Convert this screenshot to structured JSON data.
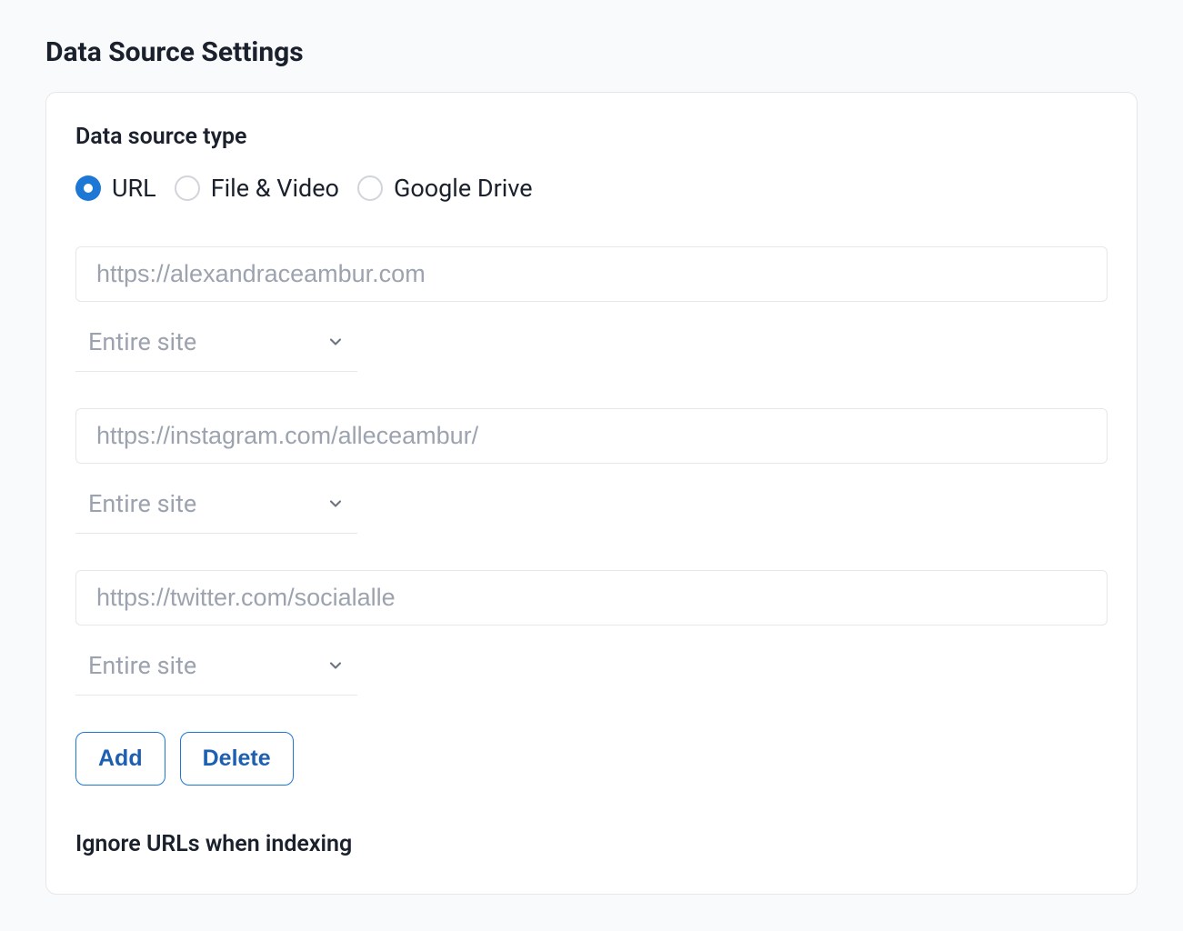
{
  "page": {
    "title": "Data Source Settings"
  },
  "card": {
    "sectionTitle": "Data source type",
    "radios": [
      {
        "label": "URL",
        "selected": true
      },
      {
        "label": "File & Video",
        "selected": false
      },
      {
        "label": "Google Drive",
        "selected": false
      }
    ],
    "entries": [
      {
        "placeholder": "https://alexandraceambur.com",
        "value": "",
        "scope": "Entire site"
      },
      {
        "placeholder": "https://instagram.com/alleceambur/",
        "value": "",
        "scope": "Entire site"
      },
      {
        "placeholder": "https://twitter.com/socialalle",
        "value": "",
        "scope": "Entire site"
      }
    ],
    "buttons": {
      "add": "Add",
      "delete": "Delete"
    },
    "ignoreTitle": "Ignore URLs when indexing"
  }
}
